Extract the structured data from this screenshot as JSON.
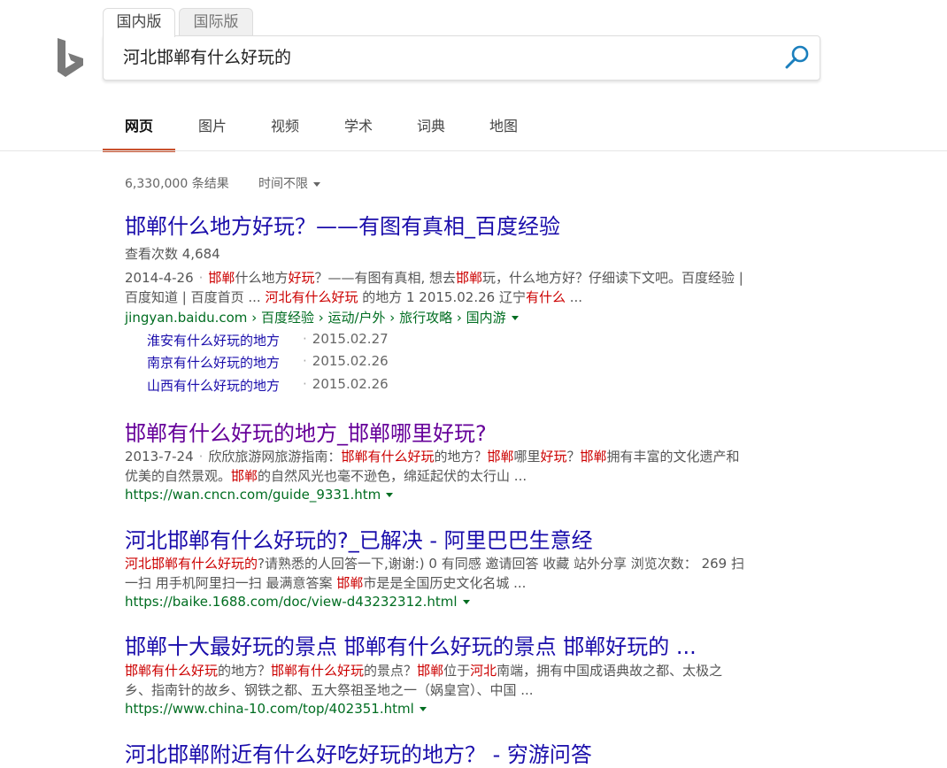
{
  "scope_tabs": [
    "国内版",
    "国际版"
  ],
  "search": {
    "query": "河北邯郸有什么好玩的"
  },
  "nav": [
    "网页",
    "图片",
    "视频",
    "学术",
    "词典",
    "地图"
  ],
  "results_count": "6,330,000 条结果",
  "time_filter": "时间不限",
  "colors": {
    "accent": "#c8502d",
    "link": "#1a0dab",
    "visited": "#660099",
    "url": "#006d21",
    "highlight": "#cc0000"
  },
  "results": [
    {
      "title": "邯郸什么地方好玩？——有图有真相_百度经验",
      "views": "查看次数 4,684",
      "date": "2014-4-26",
      "snippet1": [
        "邯郸",
        "什么地方",
        "好玩",
        "？——有图有真相, 想去",
        "邯郸",
        "玩，什么地方好？仔细读下文吧。百度经验 |"
      ],
      "snippet2": [
        "百度知道 | 百度首页 ... ",
        "河北有什么好玩",
        " 的地方 1 2015.02.26 辽宁",
        "有什么",
        " ..."
      ],
      "url": "jingyan.baidu.com › 百度经验 › 运动/户外 › 旅行攻略 › 国内游",
      "deeplinks": [
        {
          "title": "淮安有什么好玩的地方",
          "date": "2015.02.27"
        },
        {
          "title": "南京有什么好玩的地方",
          "date": "2015.02.26"
        },
        {
          "title": "山西有什么好玩的地方",
          "date": "2015.02.26"
        }
      ]
    },
    {
      "title": "邯郸有什么好玩的地方_邯郸哪里好玩?",
      "date": "2013-7-24",
      "snippet1": [
        "欣欣旅游网旅游指南：",
        "邯郸有什么好玩",
        "的地方？",
        "邯郸",
        "哪里",
        "好玩",
        "？",
        "邯郸",
        "拥有丰富的文化遗产和"
      ],
      "snippet2": [
        "优美的自然景观。",
        "邯郸",
        "的自然风光也毫不逊色，绵延起伏的太行山 ..."
      ],
      "url": "https://wan.cncn.com/guide_9331.htm"
    },
    {
      "title": "河北邯郸有什么好玩的?_已解决 - 阿里巴巴生意经",
      "snippet1": [
        "河北邯郸有什么好玩的",
        "?请熟悉的人回答一下,谢谢:) 0 有同感 邀请回答 收藏 站外分享 浏览次数： 269 扫"
      ],
      "snippet2": [
        "一扫 用手机阿里扫一扫 最满意答案 ",
        "邯郸",
        "市是是全国历史文化名城 ..."
      ],
      "url": "https://baike.1688.com/doc/view-d43232312.html"
    },
    {
      "title": "邯郸十大最好玩的景点 邯郸有什么好玩的景点 邯郸好玩的 ...",
      "snippet1": [
        "邯郸有什么好玩",
        "的地方？",
        "邯郸有什么好玩",
        "的景点？",
        "邯郸",
        "位于",
        "河北",
        "南端，拥有中国成语典故之都、太极之"
      ],
      "snippet2": [
        "乡、指南针的故乡、钢铁之都、五大祭祖圣地之一（娲皇宫）、中国 ..."
      ],
      "url": "https://www.china-10.com/top/402351.html"
    },
    {
      "title": "河北邯郸附近有什么好吃好玩的地方？ - 穷游问答"
    }
  ]
}
